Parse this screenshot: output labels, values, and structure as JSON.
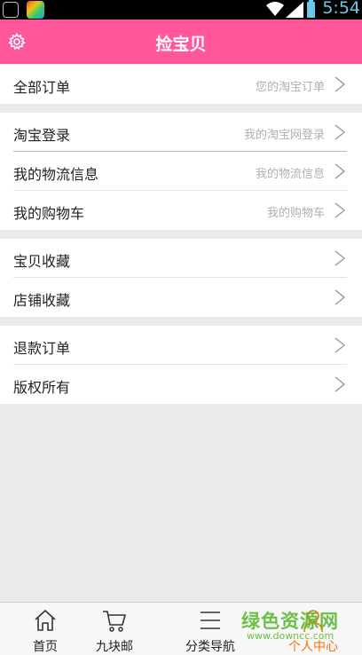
{
  "status": {
    "time": "5:54"
  },
  "header": {
    "title": "捡宝贝"
  },
  "groups": [
    {
      "rows": [
        {
          "label": "全部订单",
          "hint": "您的淘宝订单"
        }
      ]
    },
    {
      "rows": [
        {
          "label": "淘宝登录",
          "hint": "我的淘宝网登录"
        },
        {
          "label": "我的物流信息",
          "hint": "我的物流信息"
        },
        {
          "label": "我的购物车",
          "hint": "我的购物车"
        }
      ]
    },
    {
      "rows": [
        {
          "label": "宝贝收藏",
          "hint": ""
        },
        {
          "label": "店铺收藏",
          "hint": ""
        }
      ]
    },
    {
      "rows": [
        {
          "label": "退款订单",
          "hint": ""
        },
        {
          "label": "版权所有",
          "hint": ""
        }
      ]
    }
  ],
  "tabs": [
    {
      "label": "首页",
      "icon": "home-icon"
    },
    {
      "label": "九块邮",
      "icon": "cart-icon"
    },
    {
      "label": "分类导航",
      "icon": "menu-icon"
    },
    {
      "label": "个人中心",
      "icon": "person-icon",
      "active": true
    }
  ],
  "watermark": {
    "text": "绿色资源网",
    "url": "www.downcc.com"
  },
  "colors": {
    "header_bg": "#ff579a",
    "active_tab": "#ff6d00",
    "page_bg": "#ebebeb"
  }
}
